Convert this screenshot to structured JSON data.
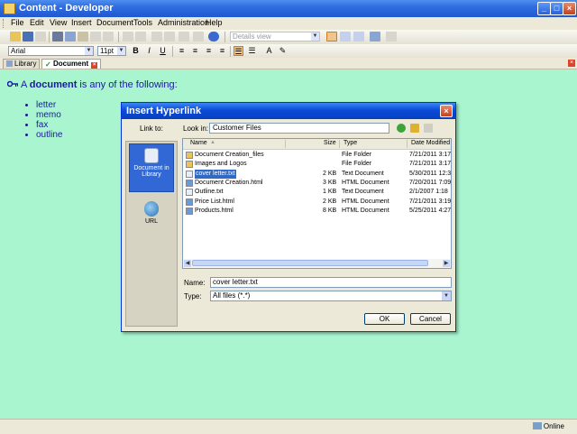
{
  "window": {
    "title": "Content - Developer",
    "min": "_",
    "max": "□",
    "close": "×"
  },
  "menu": [
    "File",
    "Edit",
    "View",
    "Insert",
    "Document",
    "Tools",
    "Administration",
    "Help"
  ],
  "toolbar": {
    "view_combo": "Details view"
  },
  "format_bar": {
    "font": "Arial",
    "size": "11pt",
    "bold": "B",
    "italic": "I",
    "underline": "U"
  },
  "tabs": [
    {
      "label": "Library"
    },
    {
      "label": "Document"
    }
  ],
  "document": {
    "heading_pre": "A ",
    "heading_bold": "document",
    "heading_post": " is any of the following:",
    "items": [
      "letter",
      "memo",
      "fax",
      "outline"
    ]
  },
  "status": {
    "online": "Online"
  },
  "dialog": {
    "title": "Insert Hyperlink",
    "close": "×",
    "link_to_label": "Link to:",
    "look_in_label": "Look in:",
    "look_in_value": "Customer Files",
    "sidebar": [
      {
        "label": "Document in Library"
      },
      {
        "label": "URL"
      }
    ],
    "columns": {
      "name": "Name",
      "size": "Size",
      "type": "Type",
      "date": "Date Modified"
    },
    "files": [
      {
        "name": "Document Creation_files",
        "size": "",
        "type": "File Folder",
        "date": "7/21/2011 3:17",
        "icon": "folder-icon"
      },
      {
        "name": "Images and Logos",
        "size": "",
        "type": "File Folder",
        "date": "7/21/2011 3:17",
        "icon": "folder-icon"
      },
      {
        "name": "cover letter.txt",
        "size": "2 KB",
        "type": "Text Document",
        "date": "5/30/2011 12:3",
        "icon": "text-file-icon"
      },
      {
        "name": "Document Creation.html",
        "size": "3 KB",
        "type": "HTML Document",
        "date": "7/20/2011 7:09",
        "icon": "html-file-icon"
      },
      {
        "name": "Outline.txt",
        "size": "1 KB",
        "type": "Text Document",
        "date": "2/1/2007 1:18",
        "icon": "text-file-icon"
      },
      {
        "name": "Price List.html",
        "size": "2 KB",
        "type": "HTML Document",
        "date": "7/21/2011 3:19",
        "icon": "html-file-icon"
      },
      {
        "name": "Products.html",
        "size": "8 KB",
        "type": "HTML Document",
        "date": "5/25/2011 4:27",
        "icon": "html-file-icon"
      }
    ],
    "selected_file_index": 2,
    "name_label": "Name:",
    "name_value": "cover letter.txt",
    "type_label": "Type:",
    "type_value": "All files (*.*)",
    "ok": "OK",
    "cancel": "Cancel"
  },
  "colors": {
    "content_bg": "#a8f5d0",
    "text": "#1a1aa0",
    "selection": "#316ac5",
    "titlebar": "#0a4bd8"
  }
}
